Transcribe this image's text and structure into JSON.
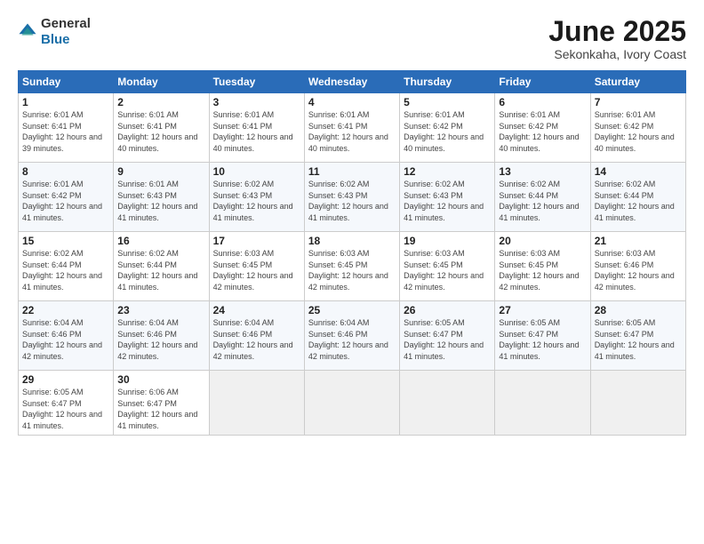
{
  "logo": {
    "general": "General",
    "blue": "Blue"
  },
  "title": "June 2025",
  "location": "Sekonkaha, Ivory Coast",
  "headers": [
    "Sunday",
    "Monday",
    "Tuesday",
    "Wednesday",
    "Thursday",
    "Friday",
    "Saturday"
  ],
  "weeks": [
    [
      {
        "day": "1",
        "sunrise": "6:01 AM",
        "sunset": "6:41 PM",
        "daylight": "12 hours and 39 minutes."
      },
      {
        "day": "2",
        "sunrise": "6:01 AM",
        "sunset": "6:41 PM",
        "daylight": "12 hours and 40 minutes."
      },
      {
        "day": "3",
        "sunrise": "6:01 AM",
        "sunset": "6:41 PM",
        "daylight": "12 hours and 40 minutes."
      },
      {
        "day": "4",
        "sunrise": "6:01 AM",
        "sunset": "6:41 PM",
        "daylight": "12 hours and 40 minutes."
      },
      {
        "day": "5",
        "sunrise": "6:01 AM",
        "sunset": "6:42 PM",
        "daylight": "12 hours and 40 minutes."
      },
      {
        "day": "6",
        "sunrise": "6:01 AM",
        "sunset": "6:42 PM",
        "daylight": "12 hours and 40 minutes."
      },
      {
        "day": "7",
        "sunrise": "6:01 AM",
        "sunset": "6:42 PM",
        "daylight": "12 hours and 40 minutes."
      }
    ],
    [
      {
        "day": "8",
        "sunrise": "6:01 AM",
        "sunset": "6:42 PM",
        "daylight": "12 hours and 41 minutes."
      },
      {
        "day": "9",
        "sunrise": "6:01 AM",
        "sunset": "6:43 PM",
        "daylight": "12 hours and 41 minutes."
      },
      {
        "day": "10",
        "sunrise": "6:02 AM",
        "sunset": "6:43 PM",
        "daylight": "12 hours and 41 minutes."
      },
      {
        "day": "11",
        "sunrise": "6:02 AM",
        "sunset": "6:43 PM",
        "daylight": "12 hours and 41 minutes."
      },
      {
        "day": "12",
        "sunrise": "6:02 AM",
        "sunset": "6:43 PM",
        "daylight": "12 hours and 41 minutes."
      },
      {
        "day": "13",
        "sunrise": "6:02 AM",
        "sunset": "6:44 PM",
        "daylight": "12 hours and 41 minutes."
      },
      {
        "day": "14",
        "sunrise": "6:02 AM",
        "sunset": "6:44 PM",
        "daylight": "12 hours and 41 minutes."
      }
    ],
    [
      {
        "day": "15",
        "sunrise": "6:02 AM",
        "sunset": "6:44 PM",
        "daylight": "12 hours and 41 minutes."
      },
      {
        "day": "16",
        "sunrise": "6:02 AM",
        "sunset": "6:44 PM",
        "daylight": "12 hours and 41 minutes."
      },
      {
        "day": "17",
        "sunrise": "6:03 AM",
        "sunset": "6:45 PM",
        "daylight": "12 hours and 42 minutes."
      },
      {
        "day": "18",
        "sunrise": "6:03 AM",
        "sunset": "6:45 PM",
        "daylight": "12 hours and 42 minutes."
      },
      {
        "day": "19",
        "sunrise": "6:03 AM",
        "sunset": "6:45 PM",
        "daylight": "12 hours and 42 minutes."
      },
      {
        "day": "20",
        "sunrise": "6:03 AM",
        "sunset": "6:45 PM",
        "daylight": "12 hours and 42 minutes."
      },
      {
        "day": "21",
        "sunrise": "6:03 AM",
        "sunset": "6:46 PM",
        "daylight": "12 hours and 42 minutes."
      }
    ],
    [
      {
        "day": "22",
        "sunrise": "6:04 AM",
        "sunset": "6:46 PM",
        "daylight": "12 hours and 42 minutes."
      },
      {
        "day": "23",
        "sunrise": "6:04 AM",
        "sunset": "6:46 PM",
        "daylight": "12 hours and 42 minutes."
      },
      {
        "day": "24",
        "sunrise": "6:04 AM",
        "sunset": "6:46 PM",
        "daylight": "12 hours and 42 minutes."
      },
      {
        "day": "25",
        "sunrise": "6:04 AM",
        "sunset": "6:46 PM",
        "daylight": "12 hours and 42 minutes."
      },
      {
        "day": "26",
        "sunrise": "6:05 AM",
        "sunset": "6:47 PM",
        "daylight": "12 hours and 41 minutes."
      },
      {
        "day": "27",
        "sunrise": "6:05 AM",
        "sunset": "6:47 PM",
        "daylight": "12 hours and 41 minutes."
      },
      {
        "day": "28",
        "sunrise": "6:05 AM",
        "sunset": "6:47 PM",
        "daylight": "12 hours and 41 minutes."
      }
    ],
    [
      {
        "day": "29",
        "sunrise": "6:05 AM",
        "sunset": "6:47 PM",
        "daylight": "12 hours and 41 minutes."
      },
      {
        "day": "30",
        "sunrise": "6:06 AM",
        "sunset": "6:47 PM",
        "daylight": "12 hours and 41 minutes."
      },
      null,
      null,
      null,
      null,
      null
    ]
  ]
}
